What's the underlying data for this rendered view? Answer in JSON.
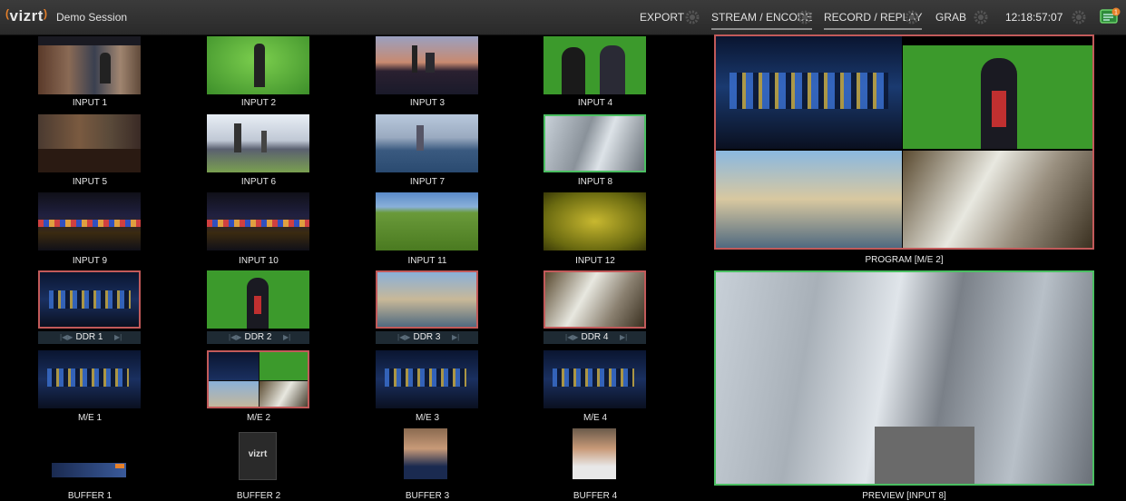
{
  "topbar": {
    "logo": "vizrt",
    "session": "Demo Session",
    "menus": [
      "EXPORT",
      "STREAM / ENCODE",
      "RECORD / REPLAY",
      "GRAB"
    ],
    "clock": "12:18:57:07",
    "notification_count": "1"
  },
  "inputs": [
    {
      "label": "INPUT 1"
    },
    {
      "label": "INPUT 2"
    },
    {
      "label": "INPUT 3"
    },
    {
      "label": "INPUT 4"
    },
    {
      "label": "INPUT 5"
    },
    {
      "label": "INPUT 6"
    },
    {
      "label": "INPUT 7"
    },
    {
      "label": "INPUT 8"
    },
    {
      "label": "INPUT 9"
    },
    {
      "label": "INPUT 10"
    },
    {
      "label": "INPUT 11"
    },
    {
      "label": "INPUT 12"
    }
  ],
  "ddrs": [
    {
      "label": "DDR 1"
    },
    {
      "label": "DDR 2"
    },
    {
      "label": "DDR 3"
    },
    {
      "label": "DDR 4"
    }
  ],
  "mes": [
    {
      "label": "M/E 1"
    },
    {
      "label": "M/E 2"
    },
    {
      "label": "M/E 3"
    },
    {
      "label": "M/E 4"
    }
  ],
  "buffers": [
    {
      "label": "BUFFER 1"
    },
    {
      "label": "BUFFER 2"
    },
    {
      "label": "BUFFER 3"
    },
    {
      "label": "BUFFER 4"
    }
  ],
  "buffer2_logo": "vizrt",
  "program": {
    "label": "PROGRAM [M/E 2]"
  },
  "preview": {
    "label": "PREVIEW [INPUT 8]"
  },
  "colors": {
    "program_tally": "#c25a5a",
    "preview_tally": "#4bbf62",
    "accent": "#e8812a"
  }
}
